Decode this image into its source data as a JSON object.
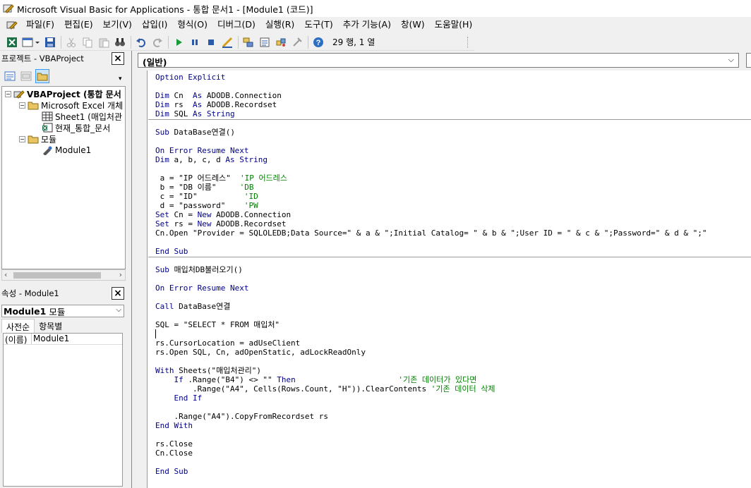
{
  "window": {
    "title": "Microsoft Visual Basic for Applications - 통합 문서1 - [Module1 (코드)]"
  },
  "menu": [
    "파일(F)",
    "편집(E)",
    "보기(V)",
    "삽입(I)",
    "형식(O)",
    "디버그(D)",
    "실행(R)",
    "도구(T)",
    "추가 기능(A)",
    "창(W)",
    "도움말(H)"
  ],
  "toolbar": {
    "position_text": "29 행, 1 열"
  },
  "project": {
    "title": "프로젝트 - VBAProject",
    "tree": [
      {
        "label": "VBAProject (통합 문서"
      },
      {
        "label": "Microsoft Excel 개체"
      },
      {
        "label": "Sheet1 (매입처관"
      },
      {
        "label": "현재_통합_문서"
      },
      {
        "label": "모듈"
      },
      {
        "label": "Module1"
      }
    ]
  },
  "properties": {
    "title": "속성 - Module1",
    "object_name": "Module1",
    "object_type": "모듈",
    "tabs": [
      "사전순",
      "항목별"
    ],
    "rows": [
      {
        "key": "(이름)",
        "value": "Module1"
      }
    ]
  },
  "code_window": {
    "procedure": "(일반)",
    "lines": [
      [
        {
          "t": "Option Explicit",
          "k": "kw"
        }
      ],
      [],
      [
        {
          "t": "Dim",
          "k": "kw"
        },
        {
          "t": " Cn  "
        },
        {
          "t": "As",
          "k": "kw"
        },
        {
          "t": " ADODB.Connection"
        }
      ],
      [
        {
          "t": "Dim",
          "k": "kw"
        },
        {
          "t": " rs  "
        },
        {
          "t": "As",
          "k": "kw"
        },
        {
          "t": " ADODB.Recordset"
        }
      ],
      [
        {
          "t": "Dim",
          "k": "kw"
        },
        {
          "t": " SQL "
        },
        {
          "t": "As String",
          "k": "kw"
        }
      ],
      [],
      [
        {
          "t": "Sub",
          "k": "kw"
        },
        {
          "t": " DataBase연결()"
        }
      ],
      [],
      [
        {
          "t": "On Error Resume Next",
          "k": "kw"
        }
      ],
      [
        {
          "t": "Dim",
          "k": "kw"
        },
        {
          "t": " a, b, c, d "
        },
        {
          "t": "As String",
          "k": "kw"
        }
      ],
      [],
      [
        {
          "t": " a = \"IP 어드레스\"  "
        },
        {
          "t": "'IP 어드레스",
          "k": "cm"
        }
      ],
      [
        {
          "t": " b = \"DB 이름\"     "
        },
        {
          "t": "'DB",
          "k": "cm"
        }
      ],
      [
        {
          "t": " c = \"ID\"          "
        },
        {
          "t": "'ID",
          "k": "cm"
        }
      ],
      [
        {
          "t": " d = \"password\"    "
        },
        {
          "t": "'PW",
          "k": "cm"
        }
      ],
      [
        {
          "t": "Set",
          "k": "kw"
        },
        {
          "t": " Cn = "
        },
        {
          "t": "New",
          "k": "kw"
        },
        {
          "t": " ADODB.Connection"
        }
      ],
      [
        {
          "t": "Set",
          "k": "kw"
        },
        {
          "t": " rs = "
        },
        {
          "t": "New",
          "k": "kw"
        },
        {
          "t": " ADODB.Recordset"
        }
      ],
      [
        {
          "t": "Cn.Open \"Provider = SQLOLEDB;Data Source=\" & a & \";Initial Catalog= \" & b & \";User ID = \" & c & \";Password=\" & d & \";\""
        }
      ],
      [],
      [
        {
          "t": "End Sub",
          "k": "kw"
        }
      ],
      [],
      [
        {
          "t": "Sub",
          "k": "kw"
        },
        {
          "t": " 매입처DB불러오기()"
        }
      ],
      [],
      [
        {
          "t": "On Error Resume Next",
          "k": "kw"
        }
      ],
      [],
      [
        {
          "t": "Call",
          "k": "kw"
        },
        {
          "t": " DataBase연결"
        }
      ],
      [],
      [
        {
          "t": "SQL = \"SELECT * FROM 매입처\""
        }
      ],
      [],
      [
        {
          "t": "rs.CursorLocation = adUseClient"
        }
      ],
      [
        {
          "t": "rs.Open SQL, Cn, adOpenStatic, adLockReadOnly"
        }
      ],
      [],
      [
        {
          "t": "With",
          "k": "kw"
        },
        {
          "t": " Sheets(\"매입처관리\")"
        }
      ],
      [
        {
          "t": "    "
        },
        {
          "t": "If",
          "k": "kw"
        },
        {
          "t": " .Range(\"B4\") <> \"\" "
        },
        {
          "t": "Then",
          "k": "kw"
        },
        {
          "t": "                      "
        },
        {
          "t": "'기존 데이터가 있다면",
          "k": "cm"
        }
      ],
      [
        {
          "t": "        .Range(\"A4\", Cells(Rows.Count, \"H\")).ClearContents "
        },
        {
          "t": "'기존 데이터 삭제",
          "k": "cm"
        }
      ],
      [
        {
          "t": "    "
        },
        {
          "t": "End If",
          "k": "kw"
        }
      ],
      [],
      [
        {
          "t": "    .Range(\"A4\").CopyFromRecordset rs"
        }
      ],
      [
        {
          "t": "End With",
          "k": "kw"
        }
      ],
      [],
      [
        {
          "t": "rs.Close"
        }
      ],
      [
        {
          "t": "Cn.Close"
        }
      ],
      [],
      [
        {
          "t": "End Sub",
          "k": "kw"
        }
      ]
    ]
  }
}
